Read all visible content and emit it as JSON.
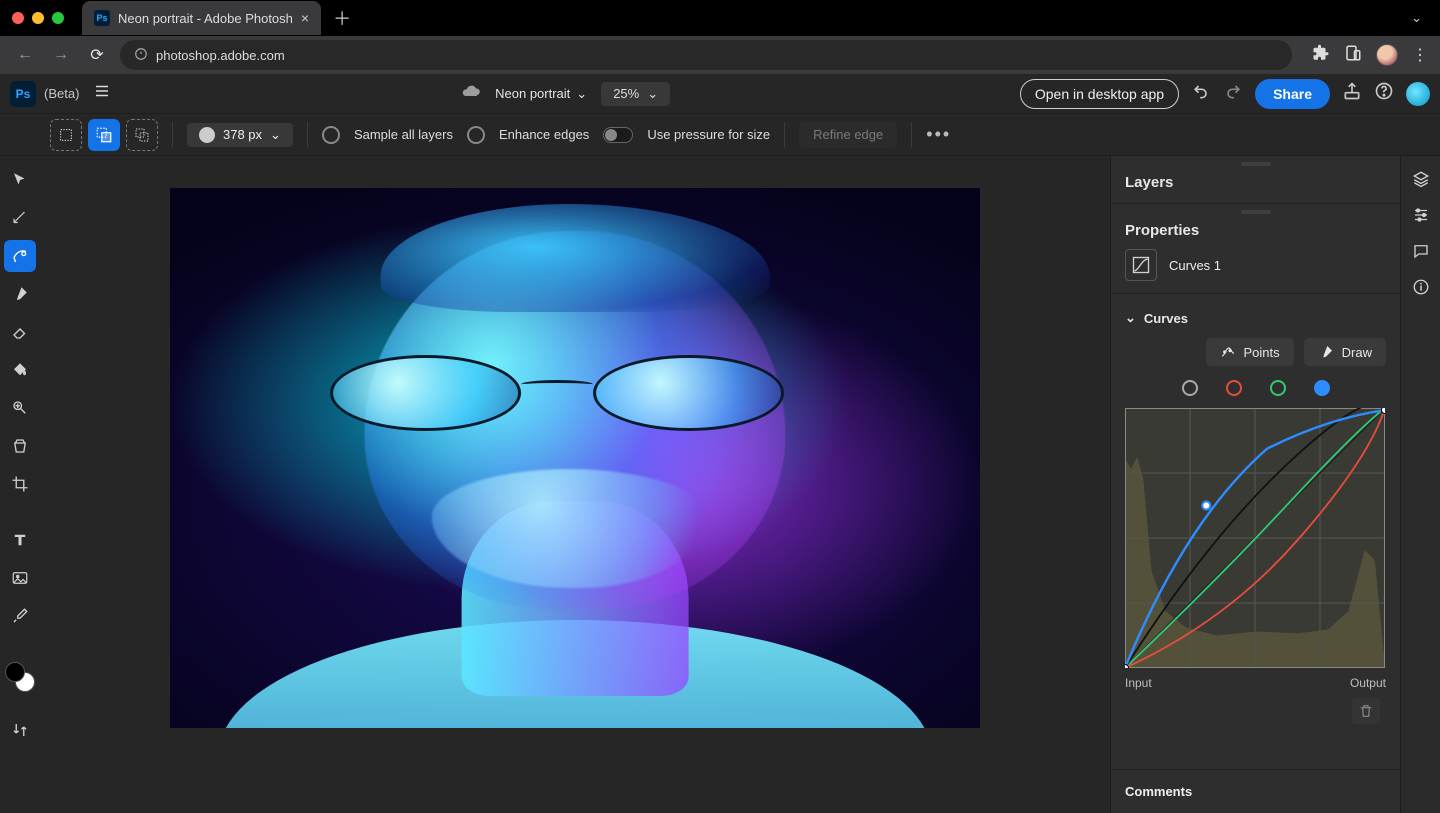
{
  "browser": {
    "tab_title": "Neon portrait - Adobe Photosh",
    "url": "photoshop.adobe.com"
  },
  "app": {
    "logo_label": "Ps",
    "beta_label": "(Beta)",
    "doc_name": "Neon portrait",
    "zoom": "25%",
    "open_desktop_label": "Open in desktop app",
    "share_label": "Share"
  },
  "options": {
    "brush_size": "378 px",
    "sample_all_label": "Sample all layers",
    "enhance_edges_label": "Enhance edges",
    "pressure_label": "Use pressure for size",
    "refine_label": "Refine edge"
  },
  "panels": {
    "layers_title": "Layers",
    "properties_title": "Properties",
    "curves_layer_name": "Curves 1",
    "curves_section_label": "Curves",
    "points_label": "Points",
    "draw_label": "Draw",
    "input_label": "Input",
    "output_label": "Output",
    "comments_title": "Comments"
  },
  "curves_channels": {
    "selected": "blue"
  }
}
